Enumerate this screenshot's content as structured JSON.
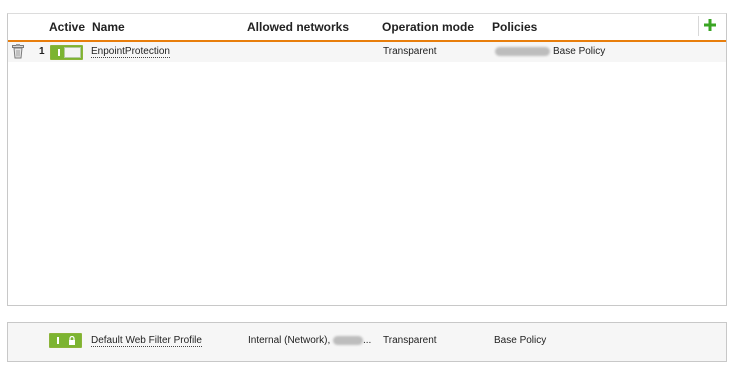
{
  "table": {
    "columns": {
      "active": "Active",
      "name": "Name",
      "allowed_networks": "Allowed networks",
      "operation_mode": "Operation mode",
      "policies": "Policies"
    },
    "rows": [
      {
        "number": "1",
        "active": true,
        "name": "EnpointProtection",
        "allowed_networks": "",
        "operation_mode": "Transparent",
        "policies": "Base Policy"
      }
    ]
  },
  "default_profile": {
    "name": "Default Web Filter Profile",
    "allowed_networks_prefix": "Internal (Network),",
    "allowed_networks_suffix": "...",
    "operation_mode": "Transparent",
    "policies": "Base Policy"
  },
  "colors": {
    "accent_orange": "#e87e0c",
    "toggle_green": "#7cb431",
    "add_green": "#3aa524"
  },
  "icons": [
    "add-icon",
    "trash-icon",
    "lock-icon"
  ]
}
